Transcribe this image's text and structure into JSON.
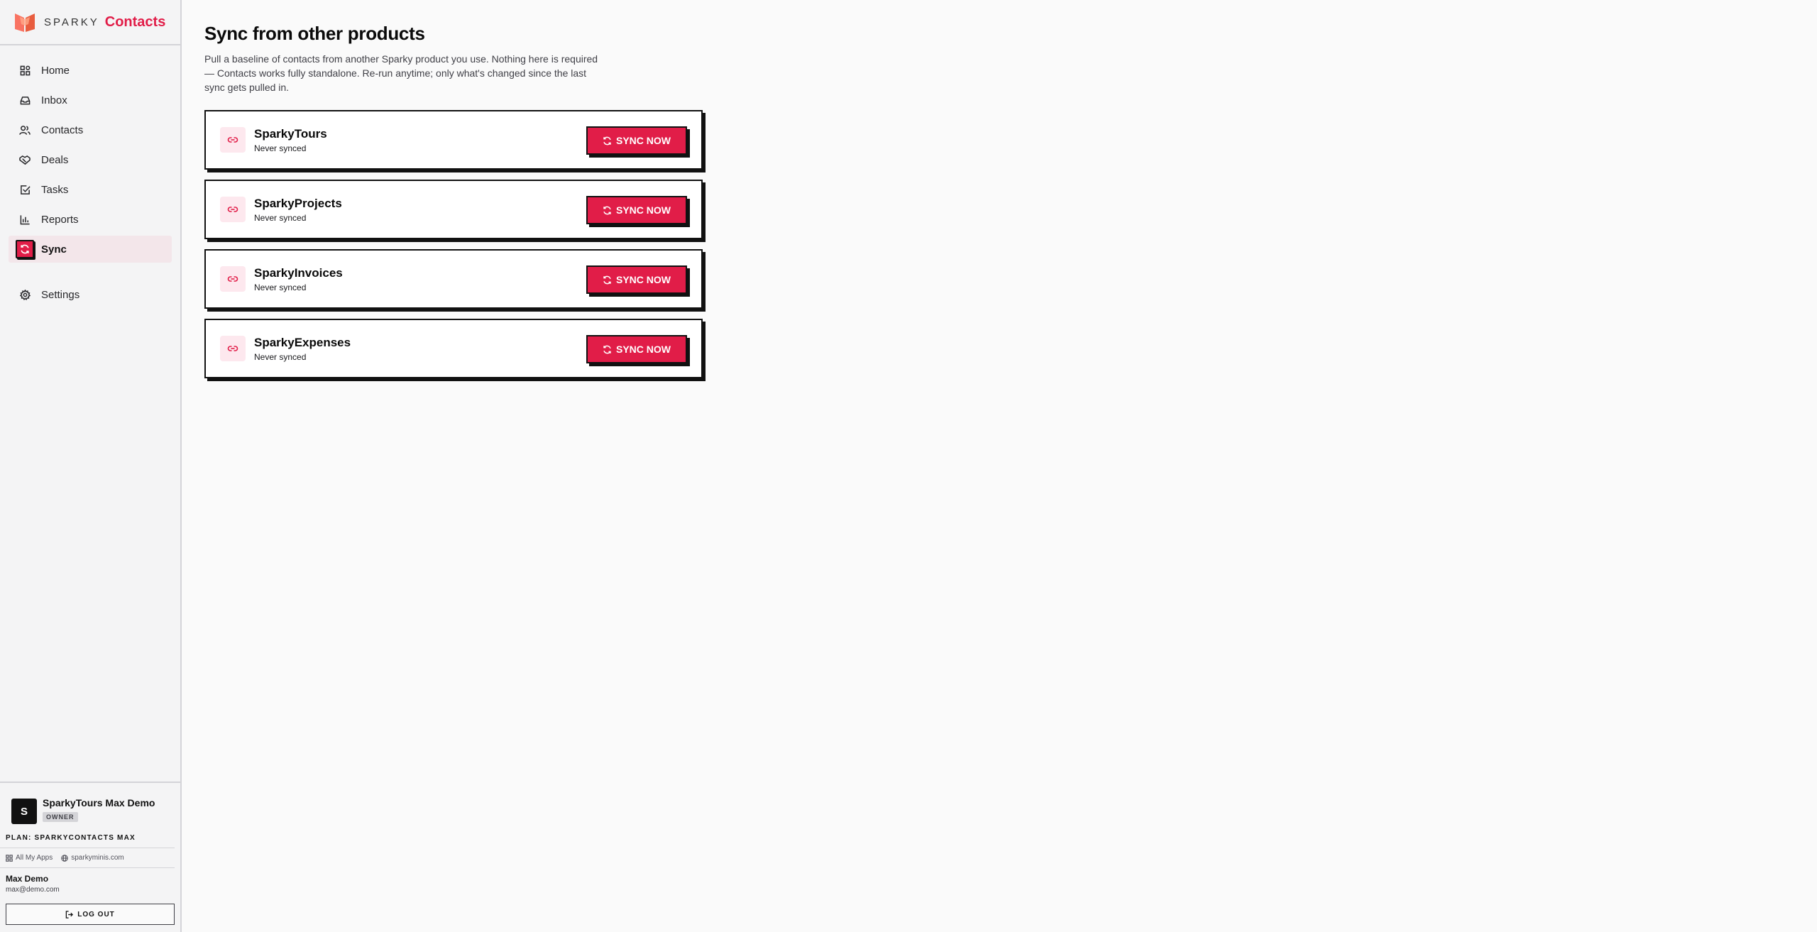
{
  "brand": {
    "small": "SPARKY",
    "app": "Contacts",
    "accent": "#e11d48"
  },
  "nav": {
    "items": [
      {
        "label": "Home",
        "icon": "home-grid-icon"
      },
      {
        "label": "Inbox",
        "icon": "inbox-icon"
      },
      {
        "label": "Contacts",
        "icon": "users-icon"
      },
      {
        "label": "Deals",
        "icon": "handshake-icon"
      },
      {
        "label": "Tasks",
        "icon": "checkbox-icon"
      },
      {
        "label": "Reports",
        "icon": "bar-chart-icon"
      },
      {
        "label": "Sync",
        "icon": "refresh-icon",
        "active": true
      }
    ],
    "settings": {
      "label": "Settings",
      "icon": "gear-icon"
    }
  },
  "account": {
    "org_initial": "S",
    "org_name": "SparkyTours Max Demo",
    "role": "OWNER",
    "plan": "PLAN: SPARKYCONTACTS MAX",
    "all_apps": "All My Apps",
    "site": "sparkyminis.com",
    "user_name": "Max Demo",
    "user_email": "max@demo.com",
    "logout": "LOG OUT"
  },
  "main": {
    "title": "Sync from other products",
    "description": "Pull a baseline of contacts from another Sparky product you use. Nothing here is required — Contacts works fully standalone. Re-run anytime; only what's changed since the last sync gets pulled in.",
    "sync_label": "SYNC NOW",
    "products": [
      {
        "name": "SparkyTours",
        "status": "Never synced"
      },
      {
        "name": "SparkyProjects",
        "status": "Never synced"
      },
      {
        "name": "SparkyInvoices",
        "status": "Never synced"
      },
      {
        "name": "SparkyExpenses",
        "status": "Never synced"
      }
    ]
  }
}
